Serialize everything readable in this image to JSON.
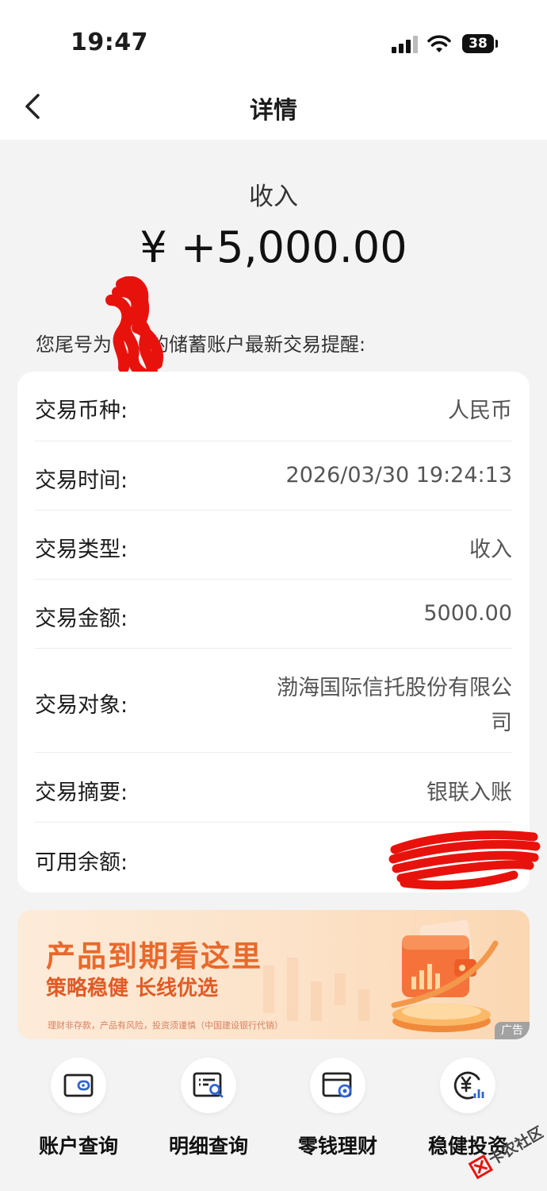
{
  "status_bar": {
    "time": "19:47",
    "battery": "38"
  },
  "nav": {
    "title": "详情"
  },
  "transaction": {
    "type_label": "收入",
    "amount": "¥ +5,000.00",
    "notice_prefix": "您尾号为",
    "notice_suffix": "的储蓄账户最新交易提醒:"
  },
  "details": [
    {
      "label": "交易币种:",
      "value": "人民币"
    },
    {
      "label": "交易时间:",
      "value": "2026/03/30 19:24:13"
    },
    {
      "label": "交易类型:",
      "value": "收入"
    },
    {
      "label": "交易金额:",
      "value": "5000.00"
    },
    {
      "label": "交易对象:",
      "value_line1": "渤海国际信托股份有限公",
      "value_line2": "司"
    },
    {
      "label": "交易摘要:",
      "value": "银联入账"
    },
    {
      "label": "可用余额:",
      "value": ""
    }
  ],
  "banner": {
    "title": "产品到期看这里",
    "subtitle": "策略稳健 长线优选",
    "note": "理财非存款，产品有风险，投资须谨慎（中国建设银行代销）",
    "ad_tag": "广告"
  },
  "shortcuts": [
    {
      "label": "账户查询",
      "icon": "wallet-icon"
    },
    {
      "label": "明细查询",
      "icon": "statement-search-icon"
    },
    {
      "label": "零钱理财",
      "icon": "card-coin-icon"
    },
    {
      "label": "稳健投资",
      "icon": "yuan-chart-icon"
    }
  ],
  "watermark": {
    "text": "卡农社区"
  },
  "colors": {
    "accent_orange": "#e9692b",
    "redact_red": "#e8120c"
  }
}
